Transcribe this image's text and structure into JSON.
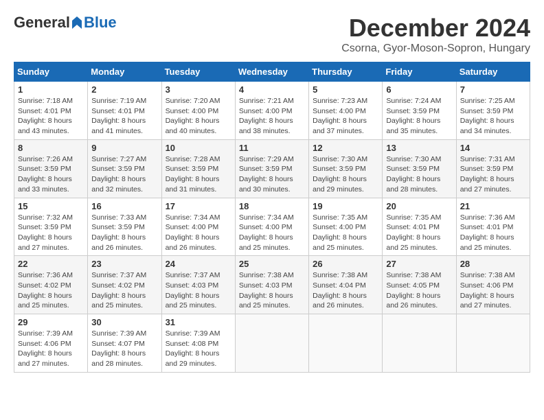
{
  "header": {
    "logo_general": "General",
    "logo_blue": "Blue",
    "month_title": "December 2024",
    "location": "Csorna, Gyor-Moson-Sopron, Hungary"
  },
  "calendar": {
    "days_of_week": [
      "Sunday",
      "Monday",
      "Tuesday",
      "Wednesday",
      "Thursday",
      "Friday",
      "Saturday"
    ],
    "weeks": [
      [
        null,
        null,
        null,
        null,
        null,
        null,
        null
      ]
    ],
    "cells": [
      {
        "day": null,
        "sunrise": null,
        "sunset": null,
        "daylight": null
      },
      {
        "day": "1",
        "sunrise": "Sunrise: 7:18 AM",
        "sunset": "Sunset: 4:01 PM",
        "daylight": "Daylight: 8 hours and 43 minutes."
      },
      {
        "day": "2",
        "sunrise": "Sunrise: 7:19 AM",
        "sunset": "Sunset: 4:01 PM",
        "daylight": "Daylight: 8 hours and 41 minutes."
      },
      {
        "day": "3",
        "sunrise": "Sunrise: 7:20 AM",
        "sunset": "Sunset: 4:00 PM",
        "daylight": "Daylight: 8 hours and 40 minutes."
      },
      {
        "day": "4",
        "sunrise": "Sunrise: 7:21 AM",
        "sunset": "Sunset: 4:00 PM",
        "daylight": "Daylight: 8 hours and 38 minutes."
      },
      {
        "day": "5",
        "sunrise": "Sunrise: 7:23 AM",
        "sunset": "Sunset: 4:00 PM",
        "daylight": "Daylight: 8 hours and 37 minutes."
      },
      {
        "day": "6",
        "sunrise": "Sunrise: 7:24 AM",
        "sunset": "Sunset: 3:59 PM",
        "daylight": "Daylight: 8 hours and 35 minutes."
      },
      {
        "day": "7",
        "sunrise": "Sunrise: 7:25 AM",
        "sunset": "Sunset: 3:59 PM",
        "daylight": "Daylight: 8 hours and 34 minutes."
      },
      {
        "day": "8",
        "sunrise": "Sunrise: 7:26 AM",
        "sunset": "Sunset: 3:59 PM",
        "daylight": "Daylight: 8 hours and 33 minutes."
      },
      {
        "day": "9",
        "sunrise": "Sunrise: 7:27 AM",
        "sunset": "Sunset: 3:59 PM",
        "daylight": "Daylight: 8 hours and 32 minutes."
      },
      {
        "day": "10",
        "sunrise": "Sunrise: 7:28 AM",
        "sunset": "Sunset: 3:59 PM",
        "daylight": "Daylight: 8 hours and 31 minutes."
      },
      {
        "day": "11",
        "sunrise": "Sunrise: 7:29 AM",
        "sunset": "Sunset: 3:59 PM",
        "daylight": "Daylight: 8 hours and 30 minutes."
      },
      {
        "day": "12",
        "sunrise": "Sunrise: 7:30 AM",
        "sunset": "Sunset: 3:59 PM",
        "daylight": "Daylight: 8 hours and 29 minutes."
      },
      {
        "day": "13",
        "sunrise": "Sunrise: 7:30 AM",
        "sunset": "Sunset: 3:59 PM",
        "daylight": "Daylight: 8 hours and 28 minutes."
      },
      {
        "day": "14",
        "sunrise": "Sunrise: 7:31 AM",
        "sunset": "Sunset: 3:59 PM",
        "daylight": "Daylight: 8 hours and 27 minutes."
      },
      {
        "day": "15",
        "sunrise": "Sunrise: 7:32 AM",
        "sunset": "Sunset: 3:59 PM",
        "daylight": "Daylight: 8 hours and 27 minutes."
      },
      {
        "day": "16",
        "sunrise": "Sunrise: 7:33 AM",
        "sunset": "Sunset: 3:59 PM",
        "daylight": "Daylight: 8 hours and 26 minutes."
      },
      {
        "day": "17",
        "sunrise": "Sunrise: 7:34 AM",
        "sunset": "Sunset: 4:00 PM",
        "daylight": "Daylight: 8 hours and 26 minutes."
      },
      {
        "day": "18",
        "sunrise": "Sunrise: 7:34 AM",
        "sunset": "Sunset: 4:00 PM",
        "daylight": "Daylight: 8 hours and 25 minutes."
      },
      {
        "day": "19",
        "sunrise": "Sunrise: 7:35 AM",
        "sunset": "Sunset: 4:00 PM",
        "daylight": "Daylight: 8 hours and 25 minutes."
      },
      {
        "day": "20",
        "sunrise": "Sunrise: 7:35 AM",
        "sunset": "Sunset: 4:01 PM",
        "daylight": "Daylight: 8 hours and 25 minutes."
      },
      {
        "day": "21",
        "sunrise": "Sunrise: 7:36 AM",
        "sunset": "Sunset: 4:01 PM",
        "daylight": "Daylight: 8 hours and 25 minutes."
      },
      {
        "day": "22",
        "sunrise": "Sunrise: 7:36 AM",
        "sunset": "Sunset: 4:02 PM",
        "daylight": "Daylight: 8 hours and 25 minutes."
      },
      {
        "day": "23",
        "sunrise": "Sunrise: 7:37 AM",
        "sunset": "Sunset: 4:02 PM",
        "daylight": "Daylight: 8 hours and 25 minutes."
      },
      {
        "day": "24",
        "sunrise": "Sunrise: 7:37 AM",
        "sunset": "Sunset: 4:03 PM",
        "daylight": "Daylight: 8 hours and 25 minutes."
      },
      {
        "day": "25",
        "sunrise": "Sunrise: 7:38 AM",
        "sunset": "Sunset: 4:03 PM",
        "daylight": "Daylight: 8 hours and 25 minutes."
      },
      {
        "day": "26",
        "sunrise": "Sunrise: 7:38 AM",
        "sunset": "Sunset: 4:04 PM",
        "daylight": "Daylight: 8 hours and 26 minutes."
      },
      {
        "day": "27",
        "sunrise": "Sunrise: 7:38 AM",
        "sunset": "Sunset: 4:05 PM",
        "daylight": "Daylight: 8 hours and 26 minutes."
      },
      {
        "day": "28",
        "sunrise": "Sunrise: 7:38 AM",
        "sunset": "Sunset: 4:06 PM",
        "daylight": "Daylight: 8 hours and 27 minutes."
      },
      {
        "day": "29",
        "sunrise": "Sunrise: 7:39 AM",
        "sunset": "Sunset: 4:06 PM",
        "daylight": "Daylight: 8 hours and 27 minutes."
      },
      {
        "day": "30",
        "sunrise": "Sunrise: 7:39 AM",
        "sunset": "Sunset: 4:07 PM",
        "daylight": "Daylight: 8 hours and 28 minutes."
      },
      {
        "day": "31",
        "sunrise": "Sunrise: 7:39 AM",
        "sunset": "Sunset: 4:08 PM",
        "daylight": "Daylight: 8 hours and 29 minutes."
      }
    ]
  }
}
